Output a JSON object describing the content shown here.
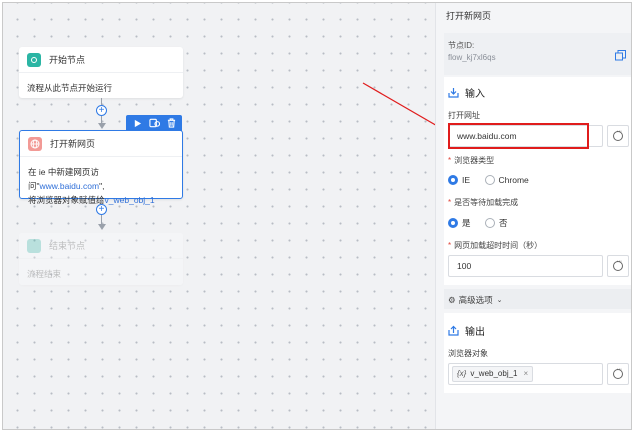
{
  "canvas": {
    "start_node": {
      "title": "开始节点",
      "desc": "流程从此节点开始运行"
    },
    "open_node": {
      "title": "打开新网页",
      "desc_line1_prefix": "在 ie 中新建网页访问\"",
      "desc_url": "www.baidu.com",
      "desc_line1_suffix": "\",",
      "desc_line2_prefix": "将浏览器对象赋值给",
      "desc_var": "v_web_obj_1"
    },
    "end_node": {
      "title": "结束节点",
      "desc": "流程结束"
    },
    "toolbar": {
      "run_icon": "play-icon",
      "copy_icon": "copy-icon",
      "delete_icon": "trash-icon"
    },
    "add_icon": "+"
  },
  "panel": {
    "title": "打开新网页",
    "node_id_label": "节点ID:",
    "node_id_value": "flow_kj7xl6qs",
    "input_section": "输入",
    "open_url_label": "打开网址",
    "open_url_value": "www.baidu.com",
    "browser_type_label": "浏览器类型",
    "browser_options": [
      "IE",
      "Chrome"
    ],
    "browser_selected": "IE",
    "wait_label": "是否等待加载完成",
    "wait_options": [
      "是",
      "否"
    ],
    "wait_selected": "是",
    "timeout_label": "网页加载超时时间（秒）",
    "timeout_value": "100",
    "advanced_label": "高级选项",
    "output_section": "输出",
    "browser_obj_label": "浏览器对象",
    "browser_obj_value": "v_web_obj_1",
    "var_prefix": "{x}",
    "tag_close": "×"
  },
  "colors": {
    "accent": "#2f7ae5",
    "highlight": "#e01c1c",
    "start": "#2bb5a4",
    "open": "#f29a96"
  }
}
